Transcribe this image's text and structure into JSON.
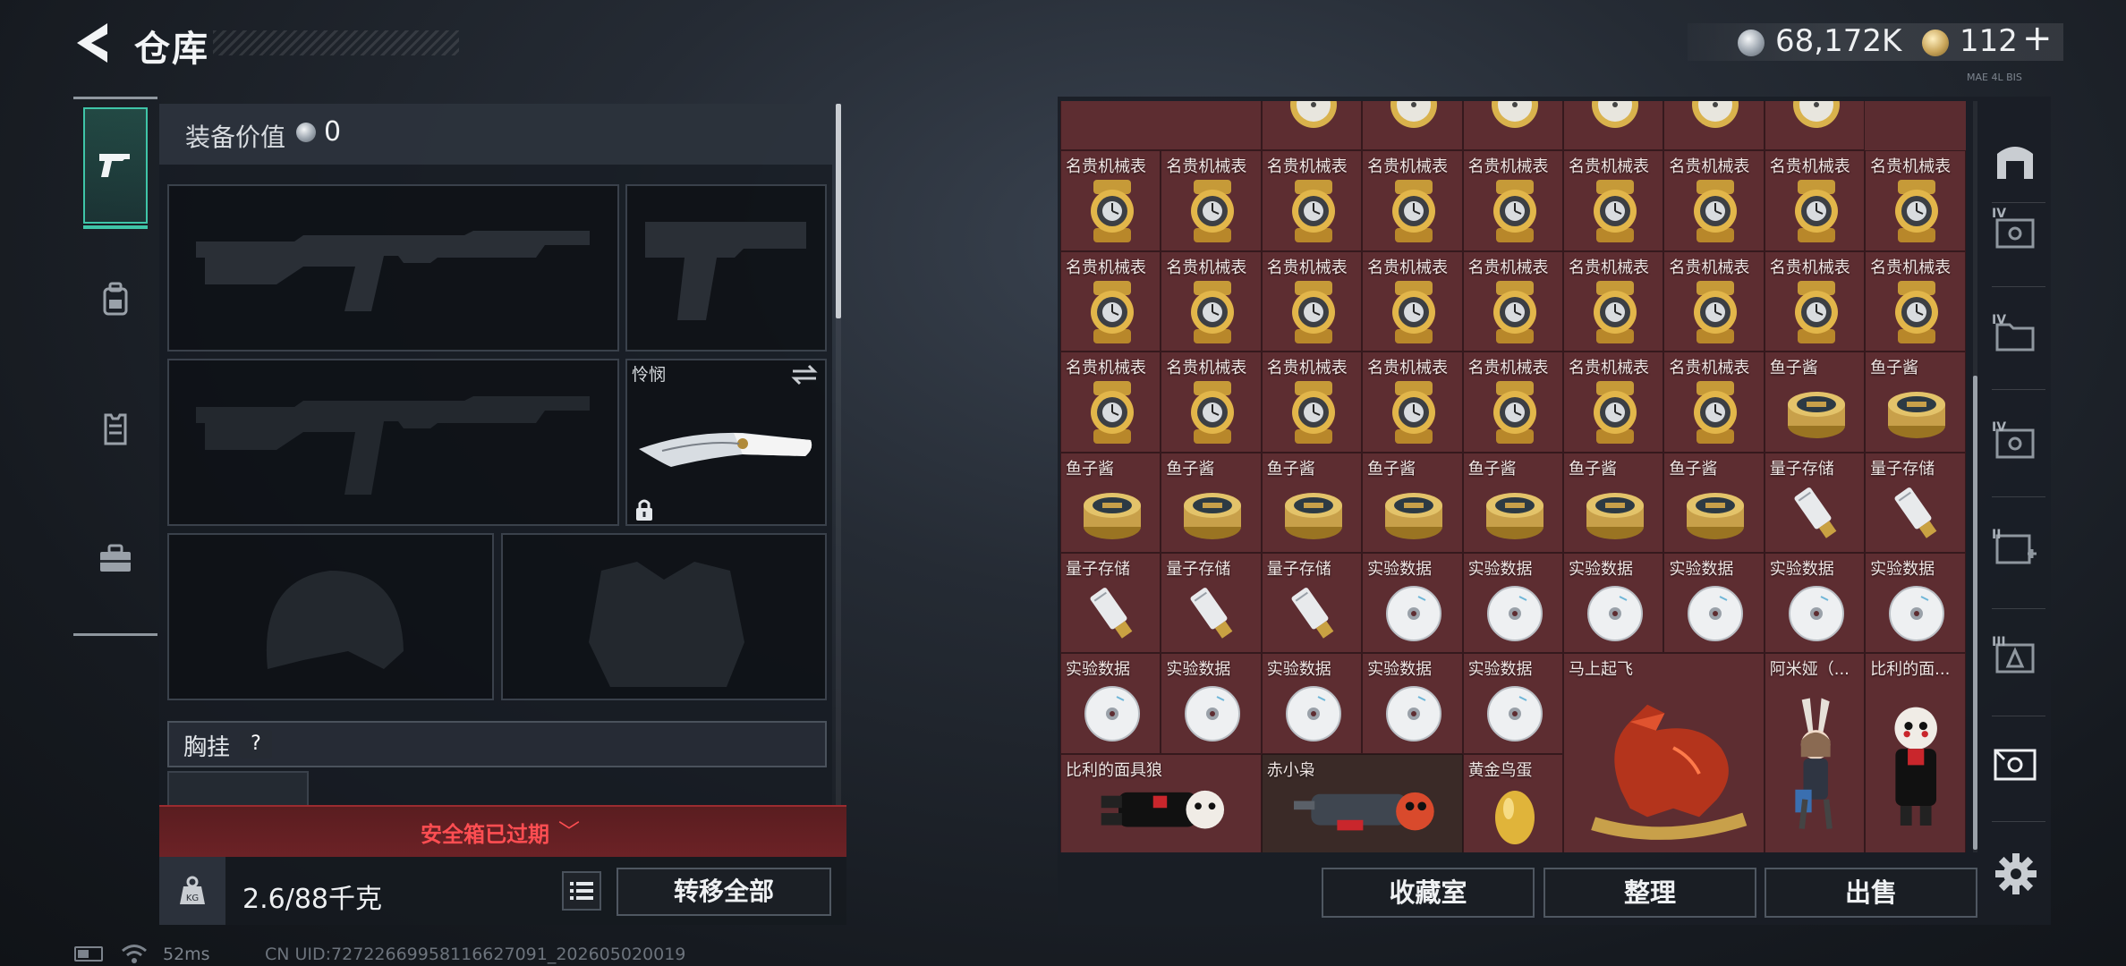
{
  "header": {
    "title": "仓库",
    "silver_value": "68,172K",
    "gold_value": "112",
    "plus": "+",
    "tiny_text": "MAE 4L BIS"
  },
  "equipment": {
    "value_label": "装备价值",
    "value_amount": "0",
    "melee_name": "怜悯",
    "chest_label": "胸挂",
    "help": "?",
    "safe_box_text": "安全箱已过期",
    "safe_box_chevron": "﹀",
    "weight_value": "2.6/88千克",
    "transfer_all": "转移全部"
  },
  "status_bar": {
    "ping": "52ms",
    "uid": "CN UID:72722669958116627091_202605020019"
  },
  "storage": {
    "rows": [
      [
        {
          "name": "",
          "type": "figure",
          "span": 2,
          "dark": false
        },
        {
          "name": "",
          "type": "compass"
        },
        {
          "name": "",
          "type": "compass"
        },
        {
          "name": "",
          "type": "compass"
        },
        {
          "name": "",
          "type": "compass"
        },
        {
          "name": "",
          "type": "compass"
        },
        {
          "name": "",
          "type": "compass"
        }
      ],
      [
        {
          "name": "名贵机械表",
          "type": "watch"
        },
        {
          "name": "名贵机械表",
          "type": "watch"
        },
        {
          "name": "名贵机械表",
          "type": "watch"
        },
        {
          "name": "名贵机械表",
          "type": "watch"
        },
        {
          "name": "名贵机械表",
          "type": "watch"
        },
        {
          "name": "名贵机械表",
          "type": "watch"
        },
        {
          "name": "名贵机械表",
          "type": "watch"
        },
        {
          "name": "名贵机械表",
          "type": "watch"
        },
        {
          "name": "名贵机械表",
          "type": "watch"
        }
      ],
      [
        {
          "name": "名贵机械表",
          "type": "watch"
        },
        {
          "name": "名贵机械表",
          "type": "watch"
        },
        {
          "name": "名贵机械表",
          "type": "watch"
        },
        {
          "name": "名贵机械表",
          "type": "watch"
        },
        {
          "name": "名贵机械表",
          "type": "watch"
        },
        {
          "name": "名贵机械表",
          "type": "watch"
        },
        {
          "name": "名贵机械表",
          "type": "watch"
        },
        {
          "name": "名贵机械表",
          "type": "watch"
        },
        {
          "name": "名贵机械表",
          "type": "watch"
        }
      ],
      [
        {
          "name": "名贵机械表",
          "type": "watch"
        },
        {
          "name": "名贵机械表",
          "type": "watch"
        },
        {
          "name": "名贵机械表",
          "type": "watch"
        },
        {
          "name": "名贵机械表",
          "type": "watch"
        },
        {
          "name": "名贵机械表",
          "type": "watch"
        },
        {
          "name": "名贵机械表",
          "type": "watch"
        },
        {
          "name": "名贵机械表",
          "type": "watch"
        },
        {
          "name": "鱼子酱",
          "type": "caviar"
        },
        {
          "name": "鱼子酱",
          "type": "caviar"
        }
      ],
      [
        {
          "name": "鱼子酱",
          "type": "caviar"
        },
        {
          "name": "鱼子酱",
          "type": "caviar"
        },
        {
          "name": "鱼子酱",
          "type": "caviar"
        },
        {
          "name": "鱼子酱",
          "type": "caviar"
        },
        {
          "name": "鱼子酱",
          "type": "caviar"
        },
        {
          "name": "鱼子酱",
          "type": "caviar"
        },
        {
          "name": "鱼子酱",
          "type": "caviar"
        },
        {
          "name": "量子存储",
          "type": "usb"
        },
        {
          "name": "量子存储",
          "type": "usb"
        }
      ],
      [
        {
          "name": "量子存储",
          "type": "usb"
        },
        {
          "name": "量子存储",
          "type": "usb"
        },
        {
          "name": "量子存储",
          "type": "usb"
        },
        {
          "name": "实验数据",
          "type": "disc"
        },
        {
          "name": "实验数据",
          "type": "disc"
        },
        {
          "name": "实验数据",
          "type": "disc"
        },
        {
          "name": "实验数据",
          "type": "disc"
        },
        {
          "name": "实验数据",
          "type": "disc"
        },
        {
          "name": "实验数据",
          "type": "disc"
        }
      ],
      [
        {
          "name": "实验数据",
          "type": "disc"
        },
        {
          "name": "实验数据",
          "type": "disc"
        },
        {
          "name": "实验数据",
          "type": "disc"
        },
        {
          "name": "实验数据",
          "type": "disc"
        },
        {
          "name": "实验数据",
          "type": "disc"
        },
        {
          "name": "马上起飞",
          "type": "horse",
          "span": 2,
          "rowspan": 2
        },
        {
          "name": "阿米娅（...",
          "type": "amiya",
          "rowspan": 2
        },
        {
          "name": "比利的面...",
          "type": "jigsaw",
          "rowspan": 2
        }
      ],
      [
        {
          "name": "比利的面具狼",
          "type": "jigsaw_lying",
          "span": 2
        },
        {
          "name": "赤小枭",
          "type": "owl",
          "span": 2,
          "dark": true
        },
        {
          "name": "黄金鸟蛋",
          "type": "egg"
        }
      ]
    ]
  },
  "storage_buttons": {
    "collection": "收藏室",
    "organize": "整理",
    "sell": "出售"
  },
  "right_rail": {
    "badges": [
      "IV",
      "IV",
      "IV",
      "II",
      "III"
    ]
  },
  "colors": {
    "accent_teal": "#3fc5a8",
    "warning_red": "#ff4e52",
    "cell_red": "#5d2d31"
  }
}
